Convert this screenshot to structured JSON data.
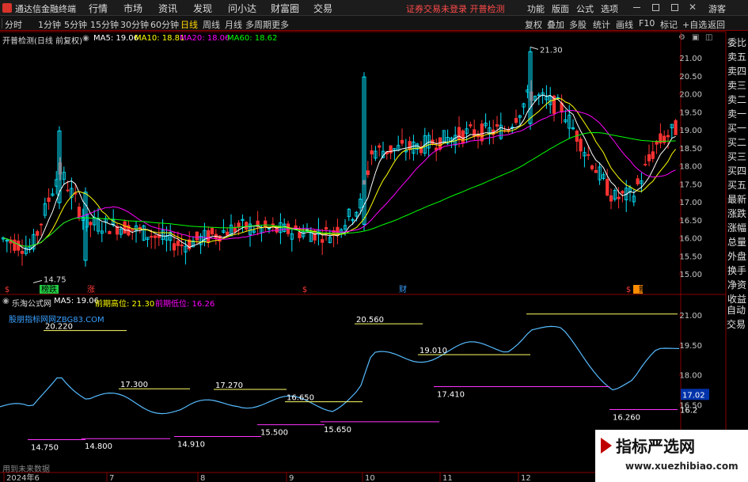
{
  "topbar": {
    "app_title": "通达信金融终端",
    "menus": [
      "行情",
      "市场",
      "资讯",
      "发现",
      "问小达",
      "财富圈",
      "交易"
    ],
    "notice": "证券交易未登录  开普检测",
    "right_menus": [
      "功能",
      "版面",
      "公式",
      "选项"
    ],
    "guest": "游客"
  },
  "toolbar": {
    "periods": [
      "分时",
      "1分钟",
      "5分钟",
      "15分钟",
      "30分钟",
      "60分钟",
      "日线",
      "周线",
      "月线",
      "多周期",
      "更多"
    ],
    "active_period": "日线",
    "right": [
      "复权",
      "叠加",
      "多股",
      "统计",
      "画线",
      "F10",
      "标记",
      "+自选",
      "返回"
    ]
  },
  "main": {
    "title": "开普检测(日线 前复权)",
    "ma_labels": [
      {
        "text": "MA5: 19.06",
        "color": "#ffffff"
      },
      {
        "text": "MA10: 18.81",
        "color": "#ffff00"
      },
      {
        "text": "MA20: 18.06",
        "color": "#ff00ff"
      },
      {
        "text": "MA60: 18.62",
        "color": "#00ff00"
      }
    ],
    "y_ticks": [
      "21.00",
      "20.50",
      "20.00",
      "19.50",
      "19.00",
      "18.50",
      "18.00",
      "17.50",
      "17.00",
      "16.50",
      "16.00",
      "15.50",
      "15.00"
    ],
    "high_label": "21.30",
    "low_label": "14.75",
    "markers": [
      {
        "text": "榜跌",
        "kind": "green"
      },
      {
        "text": "涨",
        "kind": "red"
      },
      {
        "text": "财",
        "kind": "blue"
      },
      {
        "text": "$",
        "kind": "red"
      },
      {
        "text": "$",
        "kind": "red"
      },
      {
        "text": "$",
        "kind": "red"
      },
      {
        "text": "颤",
        "kind": "orange"
      }
    ]
  },
  "sidebar_top": [
    "委比",
    "卖五",
    "卖四",
    "卖三",
    "卖二",
    "卖一",
    "买一",
    "买二",
    "买三",
    "买四",
    "买五",
    "最新",
    "涨跌",
    "涨幅",
    "总量",
    "外盘",
    "换手",
    "净资",
    "收益"
  ],
  "sidebar_bottom": [
    "自动",
    "交易"
  ],
  "indicator": {
    "name": "乐淘公式网",
    "labels": [
      {
        "text": "MA5: 19.06",
        "color": "#ffffff"
      },
      {
        "text": "前期高位: 21.30",
        "color": "#ffff00"
      },
      {
        "text": "前期低位: 16.26",
        "color": "#ff00ff"
      }
    ],
    "watermark_site": "股朋指标网网ZBG83.COM",
    "y_ticks": [
      "21.00",
      "19.50",
      "18.00",
      "16.50"
    ],
    "current_value": "17.02",
    "high_levels": [
      "20.220",
      "20.560",
      "19.010",
      "17.300",
      "17.270",
      "16.650"
    ],
    "low_levels": [
      "14.750",
      "14.800",
      "14.910",
      "15.500",
      "15.650",
      "17.410",
      "16.260"
    ],
    "edge_value": "16.2",
    "footer_note": "用到未来数据"
  },
  "x_axis": [
    "2024年6",
    "7",
    "8",
    "9",
    "10",
    "11",
    "12"
  ],
  "brand_watermark": {
    "title": "指标严选网",
    "url": "www.xuezhibiao.com"
  },
  "colors": {
    "up": "#00e5ff",
    "down": "#ff3232",
    "ma5": "#ffffff",
    "ma10": "#ffff00",
    "ma20": "#ff00ff",
    "ma60": "#00ff00",
    "high_line": "#ffff66",
    "low_line": "#ff33ff",
    "signal": "#55bbff"
  }
}
